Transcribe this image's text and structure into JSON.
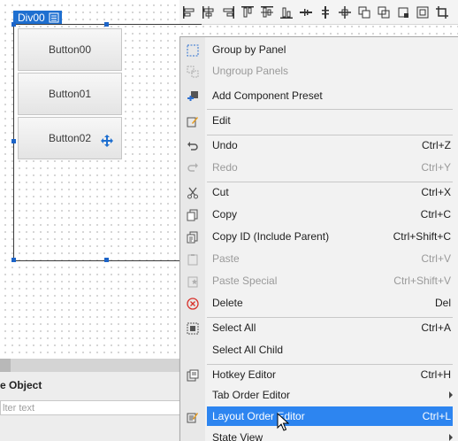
{
  "toolbar": {
    "icons": [
      "align-left-icon",
      "align-center-h-icon",
      "align-right-icon",
      "align-top-icon",
      "align-middle-icon",
      "align-bottom-icon",
      "distribute-h-icon",
      "distribute-v-icon",
      "center-move-icon",
      "bring-front-icon",
      "send-back-icon",
      "same-size-icon",
      "fit-icon",
      "crop-icon"
    ]
  },
  "canvas": {
    "div_label": "Div00",
    "buttons": [
      "Button00",
      "Button01",
      "Button02"
    ]
  },
  "bottom_panel": {
    "title": "e Object",
    "filter_placeholder": "lter text"
  },
  "menu": {
    "items": [
      {
        "label": "Group by Panel",
        "shortcut": "",
        "disabled": false
      },
      {
        "label": "Ungroup Panels",
        "shortcut": "",
        "disabled": true
      },
      {
        "label": "Add Component Preset",
        "shortcut": "",
        "disabled": false
      },
      {
        "label": "Edit",
        "shortcut": "",
        "disabled": false
      },
      {
        "label": "Undo",
        "shortcut": "Ctrl+Z",
        "disabled": false
      },
      {
        "label": "Redo",
        "shortcut": "Ctrl+Y",
        "disabled": true
      },
      {
        "label": "Cut",
        "shortcut": "Ctrl+X",
        "disabled": false
      },
      {
        "label": "Copy",
        "shortcut": "Ctrl+C",
        "disabled": false
      },
      {
        "label": "Copy ID (Include Parent)",
        "shortcut": "Ctrl+Shift+C",
        "disabled": false
      },
      {
        "label": "Paste",
        "shortcut": "Ctrl+V",
        "disabled": true
      },
      {
        "label": "Paste Special",
        "shortcut": "Ctrl+Shift+V",
        "disabled": true
      },
      {
        "label": "Delete",
        "shortcut": "Del",
        "disabled": false
      },
      {
        "label": "Select All",
        "shortcut": "Ctrl+A",
        "disabled": false
      },
      {
        "label": "Select All Child",
        "shortcut": "",
        "disabled": false
      },
      {
        "label": "Hotkey Editor",
        "shortcut": "Ctrl+H",
        "disabled": false
      },
      {
        "label": "Tab Order Editor",
        "shortcut": "",
        "disabled": false
      },
      {
        "label": "Layout Order Editor",
        "shortcut": "Ctrl+L",
        "disabled": false
      },
      {
        "label": "State View",
        "shortcut": "",
        "disabled": false
      }
    ]
  },
  "colors": {
    "highlight": "#2d85f0",
    "selection": "#1e6fd0"
  }
}
